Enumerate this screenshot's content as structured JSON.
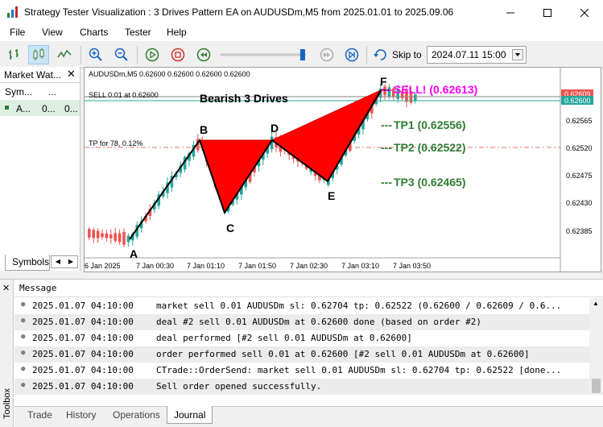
{
  "window": {
    "title": "Strategy Tester Visualization : 3 Drives Pattern EA on AUDUSDm,M5 from 2025.01.01 to 2025.09.06"
  },
  "menu": [
    "File",
    "View",
    "Charts",
    "Tester",
    "Help"
  ],
  "toolbar": {
    "skip_label": "Skip to",
    "skip_date": "2024.07.11 15:00",
    "speed_fraction": 0.98
  },
  "market_watch": {
    "title": "Market Wat...",
    "col_symbol": "Sym...",
    "col_value": "...",
    "row_symbol": "A...",
    "row_value": "0...",
    "row_value2": "0...",
    "tab_label": "Symbols"
  },
  "chart": {
    "info_line": "AUDUSDm,M5  0.62600 0.62600 0.62600 0.62600",
    "sell_label": "SELL 0.01 at 0.62600",
    "tp_label": "TP for 78, 0.12%",
    "pattern_title": "Bearish 3 Drives",
    "sell_signal": "SELL! (0.62613)",
    "tp1": "TP1 (0.62556)",
    "tp2": "TP2 (0.62522)",
    "tp3": "TP3 (0.62465)",
    "points": {
      "A": "A",
      "B": "B",
      "C": "C",
      "D": "D",
      "E": "E",
      "F": "F"
    },
    "price_labels": [
      "0.62565",
      "0.62520",
      "0.62475",
      "0.62430",
      "0.62385"
    ],
    "price_tag_top": "0.62609",
    "price_tag_bottom": "0.62600",
    "time_labels": [
      "6 Jan 2025",
      "7 Jan 00:30",
      "7 Jan 01:10",
      "7 Jan 01:50",
      "7 Jan 02:30",
      "7 Jan 03:10",
      "7 Jan 03:50"
    ],
    "colors": {
      "up": "#26a69a",
      "down": "#ef5350",
      "pattern": "#ff0000",
      "sell_signal": "#ff00ff",
      "tp": "#2e7d32"
    }
  },
  "journal": {
    "header": "Message",
    "rows": [
      {
        "time": "2025.01.07 04:10:00",
        "msg": "market sell 0.01 AUDUSDm sl: 0.62704 tp: 0.62522 (0.62600 / 0.62609 / 0.6..."
      },
      {
        "time": "2025.01.07 04:10:00",
        "msg": "deal #2 sell 0.01 AUDUSDm at 0.62600 done (based on order #2)"
      },
      {
        "time": "2025.01.07 04:10:00",
        "msg": "deal performed [#2 sell 0.01 AUDUSDm at 0.62600]"
      },
      {
        "time": "2025.01.07 04:10:00",
        "msg": "order performed sell 0.01 at 0.62600 [#2 sell 0.01 AUDUSDm at 0.62600]"
      },
      {
        "time": "2025.01.07 04:10:00",
        "msg": "CTrade::OrderSend: market sell 0.01 AUDUSDm sl: 0.62704 tp: 0.62522 [done..."
      },
      {
        "time": "2025.01.07 04:10:00",
        "msg": "Sell order opened successfully."
      }
    ],
    "tabs": [
      "Trade",
      "History",
      "Operations",
      "Journal"
    ],
    "active_tab": "Journal",
    "toolbox_label": "Toolbox"
  }
}
